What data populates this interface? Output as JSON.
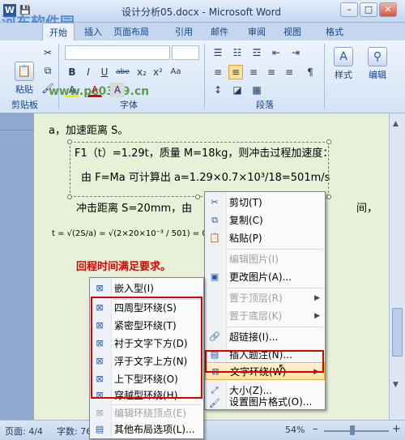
{
  "window": {
    "title": "设计分析05.docx - Microsoft Word",
    "controls": [
      "–",
      "□",
      "✕"
    ]
  },
  "watermark": {
    "brand": "河东软件园",
    "url": "www.pc0359.cn"
  },
  "ribbon_tabs": [
    "开始",
    "插入",
    "页面布局",
    "引用",
    "邮件",
    "审阅",
    "视图",
    "格式"
  ],
  "ribbon": {
    "paste_label": "粘贴",
    "clipboard_group": "剪贴板",
    "font_group": "字体",
    "paragraph_group": "段落",
    "styles_label": "样式",
    "edit_label": "编辑",
    "font_buttons": [
      "B",
      "I",
      "U",
      "abe",
      "x₂",
      "x²",
      "Aa",
      "A",
      "A",
      "A"
    ],
    "para_buttons": [
      "≡",
      "≡",
      "≡",
      "≡",
      "≡",
      "¶"
    ]
  },
  "document": {
    "line1": "a，加速距离 S。",
    "line2": "F1（t）=1.29t，质量 M=18kg，则冲击过程加速度：",
    "line3": "由 F=Ma    可计算出 a=1.29×0.7×10³/18=501m/s",
    "line4": "冲击距离  S=20mm，由",
    "line4_end": "间，",
    "formula": "t = √(2S/a) = √(2×20×10⁻³ / 501) = 0.008935  < 0.",
    "warning": "回程时间满足要求。"
  },
  "context_menu": [
    {
      "icon": "cut-icon",
      "glyph": "✂",
      "label": "剪切(T)",
      "enabled": true
    },
    {
      "icon": "copy-icon",
      "glyph": "⧉",
      "label": "复制(C)",
      "enabled": true
    },
    {
      "icon": "paste-icon",
      "glyph": "📋",
      "label": "粘贴(P)",
      "enabled": true
    },
    {
      "icon": "edit-picture-icon",
      "glyph": "",
      "label": "编辑图片(I)",
      "enabled": false
    },
    {
      "icon": "change-picture-icon",
      "glyph": "▣",
      "label": "更改图片(A)...",
      "enabled": true
    },
    {
      "icon": "bring-front-icon",
      "glyph": "",
      "label": "置于顶层(R)",
      "enabled": false,
      "submenu": true
    },
    {
      "icon": "send-back-icon",
      "glyph": "",
      "label": "置于底层(K)",
      "enabled": false,
      "submenu": true
    },
    {
      "icon": "hyperlink-icon",
      "glyph": "🔗",
      "label": "超链接(I)...",
      "enabled": true
    },
    {
      "icon": "caption-icon",
      "glyph": "▤",
      "label": "插入题注(N)...",
      "enabled": true
    },
    {
      "icon": "text-wrap-icon",
      "glyph": "⊠",
      "label": "文字环绕(W)",
      "enabled": true,
      "submenu": true,
      "highlighted": true
    },
    {
      "icon": "size-icon",
      "glyph": "⤢",
      "label": "大小(Z)...",
      "enabled": true
    },
    {
      "icon": "format-picture-icon",
      "glyph": "🖌",
      "label": "设置图片格式(O)...",
      "enabled": true
    }
  ],
  "wrap_submenu": [
    {
      "label": "嵌入型(I)",
      "enabled": true
    },
    {
      "label": "四周型环绕(S)",
      "enabled": true
    },
    {
      "label": "紧密型环绕(T)",
      "enabled": true
    },
    {
      "label": "衬于文字下方(D)",
      "enabled": true
    },
    {
      "label": "浮于文字上方(N)",
      "enabled": true
    },
    {
      "label": "上下型环绕(O)",
      "enabled": true
    },
    {
      "label": "穿越型环绕(H)",
      "enabled": true
    },
    {
      "label": "编辑环绕顶点(E)",
      "enabled": false
    },
    {
      "label": "其他布局选项(L)...",
      "enabled": true
    }
  ],
  "status": {
    "page": "页面: 4/4",
    "words": "字数: 76",
    "zoom": "54%",
    "zoom_minus": "–",
    "zoom_plus": "+"
  }
}
